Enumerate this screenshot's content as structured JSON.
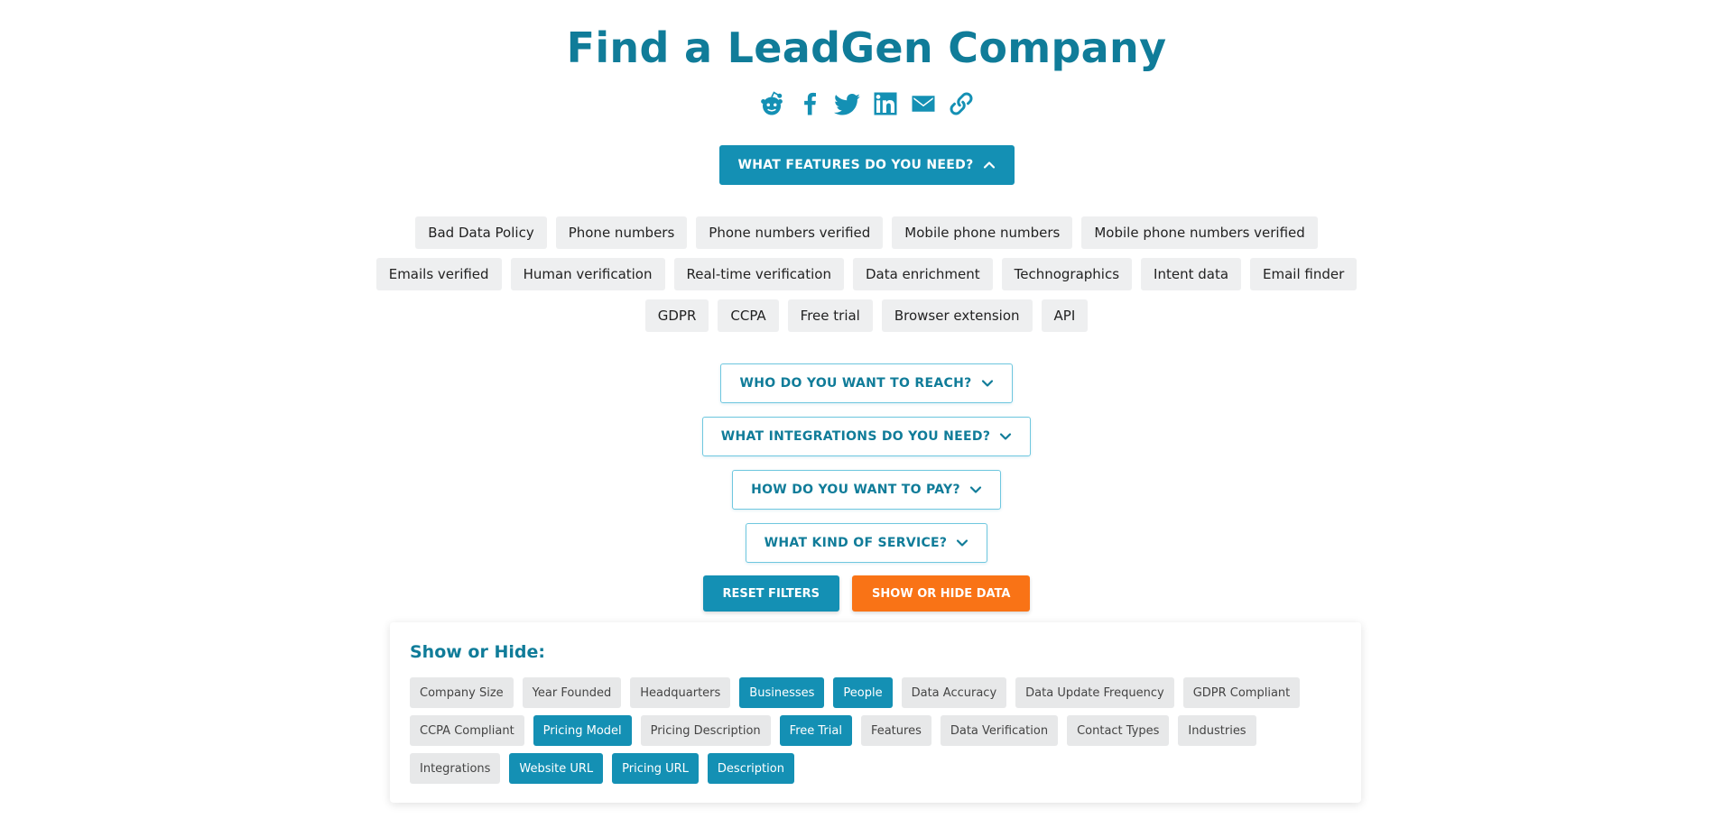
{
  "page": {
    "title": "Find a LeadGen Company"
  },
  "share": {
    "icons": [
      "reddit-icon",
      "facebook-icon",
      "twitter-icon",
      "linkedin-icon",
      "email-icon",
      "link-icon"
    ]
  },
  "filters": {
    "features_toggle": "WHAT FEATURES DO YOU NEED?",
    "features": [
      [
        "Bad Data Policy",
        "Phone numbers",
        "Phone numbers verified",
        "Mobile phone numbers",
        "Mobile phone numbers verified"
      ],
      [
        "Emails verified",
        "Human verification",
        "Real-time verification",
        "Data enrichment",
        "Technographics",
        "Intent data",
        "Email finder"
      ],
      [
        "GDPR",
        "CCPA",
        "Free trial",
        "Browser extension",
        "API"
      ]
    ],
    "reach_toggle": "WHO DO YOU WANT TO REACH?",
    "integrations_toggle": "WHAT INTEGRATIONS DO YOU NEED?",
    "pay_toggle": "HOW DO YOU WANT TO PAY?",
    "service_toggle": "WHAT KIND OF SERVICE?"
  },
  "actions": {
    "reset": "RESET FILTERS",
    "show_hide": "SHOW OR HIDE DATA"
  },
  "columns_panel": {
    "title": "Show or Hide:",
    "chips": [
      {
        "label": "Company Size",
        "active": false
      },
      {
        "label": "Year Founded",
        "active": false
      },
      {
        "label": "Headquarters",
        "active": false
      },
      {
        "label": "Businesses",
        "active": true
      },
      {
        "label": "People",
        "active": true
      },
      {
        "label": "Data Accuracy",
        "active": false
      },
      {
        "label": "Data Update Frequency",
        "active": false
      },
      {
        "label": "GDPR Compliant",
        "active": false
      },
      {
        "label": "CCPA Compliant",
        "active": false
      },
      {
        "label": "Pricing Model",
        "active": true
      },
      {
        "label": "Pricing Description",
        "active": false
      },
      {
        "label": "Free Trial",
        "active": true
      },
      {
        "label": "Features",
        "active": false
      },
      {
        "label": "Data Verification",
        "active": false
      },
      {
        "label": "Contact Types",
        "active": false
      },
      {
        "label": "Industries",
        "active": false
      },
      {
        "label": "Integrations",
        "active": false
      },
      {
        "label": "Website URL",
        "active": true
      },
      {
        "label": "Pricing URL",
        "active": true
      },
      {
        "label": "Description",
        "active": true
      }
    ]
  },
  "colors": {
    "primary": "#1490b4",
    "title": "#107c99",
    "accent": "#f97316",
    "chip_bg": "#eeeff0"
  }
}
